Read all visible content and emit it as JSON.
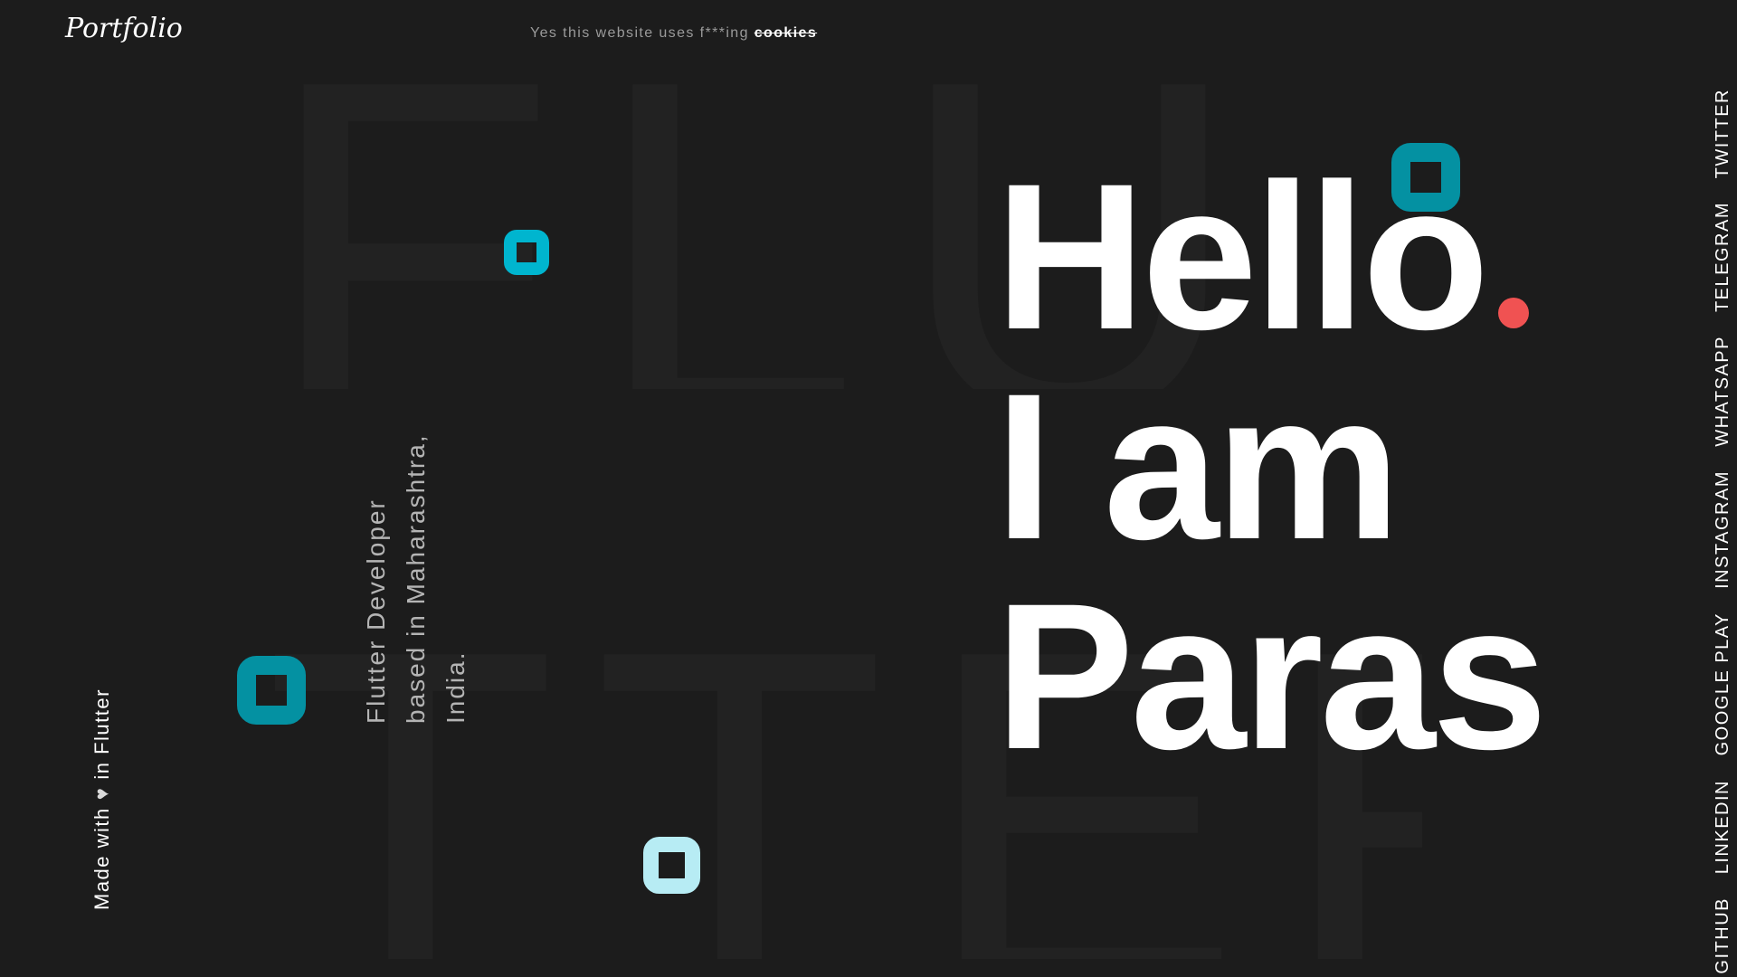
{
  "header": {
    "logo": "Portfolio",
    "cookie_text": "Yes this website uses f***ing ",
    "cookie_link": "cookies"
  },
  "background": {
    "top_word": "FLU",
    "bottom_word": "TTER"
  },
  "sidebar_left": {
    "made_with_prefix": "Made with",
    "made_with_suffix": "in Flutter",
    "heart_icon": "heart-icon"
  },
  "tagline": {
    "line1": "Flutter Developer",
    "line2": "based in Maharashtra,",
    "line3": "India."
  },
  "greeting": {
    "line1": "Hello",
    "line2": "I am",
    "line3": "Paras"
  },
  "social_links": [
    "GITHUB",
    "LINKEDIN",
    "GOOGLE PLAY",
    "INSTAGRAM",
    "WHATSAPP",
    "TELEGRAM",
    "TWITTER"
  ],
  "colors": {
    "background": "#1c1c1c",
    "accent_cyan": "#00b5cf",
    "accent_teal": "#0491a2",
    "accent_light": "#b7ecf4",
    "dot_red": "#f05252"
  }
}
